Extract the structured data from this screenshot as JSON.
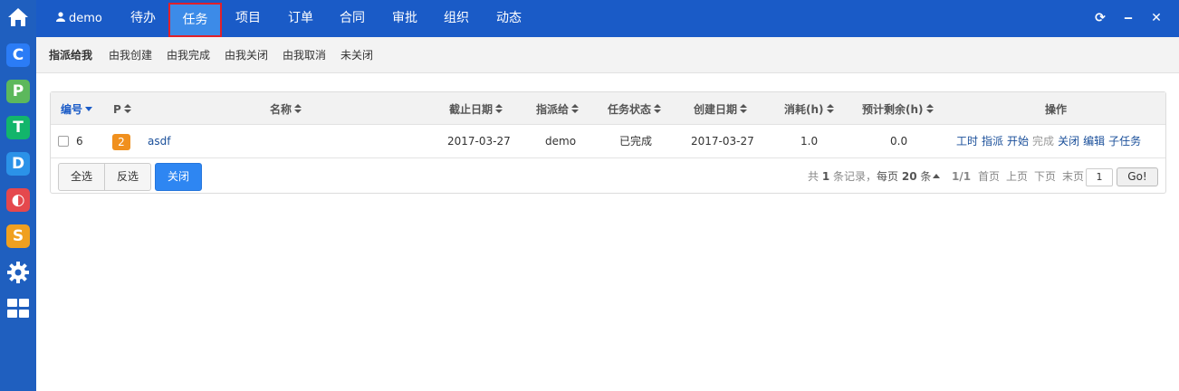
{
  "user": {
    "name": "demo"
  },
  "topnav": {
    "items": [
      {
        "label": "待办"
      },
      {
        "label": "任务"
      },
      {
        "label": "项目"
      },
      {
        "label": "订单"
      },
      {
        "label": "合同"
      },
      {
        "label": "审批"
      },
      {
        "label": "组织"
      },
      {
        "label": "动态"
      }
    ],
    "active": "任务",
    "window_buttons": {
      "refresh": "⟳",
      "minimize": "‒",
      "close": "✕"
    }
  },
  "leftbar": {
    "icons": [
      {
        "name": "home-icon",
        "glyph": "⌂"
      },
      {
        "name": "app-c-icon",
        "glyph": "C"
      },
      {
        "name": "app-p-icon",
        "glyph": "P"
      },
      {
        "name": "app-t-icon",
        "glyph": "T"
      },
      {
        "name": "app-d-icon",
        "glyph": "D"
      },
      {
        "name": "app-o-icon",
        "glyph": "◐"
      },
      {
        "name": "app-s-icon",
        "glyph": "S"
      },
      {
        "name": "gear-icon",
        "glyph": "⚙"
      },
      {
        "name": "grid-icon",
        "glyph": "▦"
      }
    ]
  },
  "subnav": {
    "items": [
      {
        "label": "指派给我"
      },
      {
        "label": "由我创建"
      },
      {
        "label": "由我完成"
      },
      {
        "label": "由我关闭"
      },
      {
        "label": "由我取消"
      },
      {
        "label": "未关闭"
      }
    ],
    "active": "指派给我"
  },
  "table": {
    "headers": {
      "id": "编号",
      "priority": "P",
      "name": "名称",
      "deadline": "截止日期",
      "assigned_to": "指派给",
      "status": "任务状态",
      "created": "创建日期",
      "consumed": "消耗(h)",
      "left": "预计剩余(h)",
      "actions": "操作"
    },
    "rows": [
      {
        "id": "6",
        "priority": "2",
        "name": "asdf",
        "deadline": "2017-03-27",
        "assigned_to": "demo",
        "status": "已完成",
        "created": "2017-03-27",
        "consumed": "1.0",
        "left": "0.0",
        "actions": [
          {
            "label": "工时",
            "enabled": true
          },
          {
            "label": "指派",
            "enabled": true
          },
          {
            "label": "开始",
            "enabled": true
          },
          {
            "label": "完成",
            "enabled": false
          },
          {
            "label": "关闭",
            "enabled": true
          },
          {
            "label": "编辑",
            "enabled": true
          },
          {
            "label": "子任务",
            "enabled": true
          }
        ]
      }
    ]
  },
  "footer": {
    "select_all": "全选",
    "invert": "反选",
    "close": "关闭",
    "pager": {
      "total_prefix": "共",
      "total": "1",
      "total_suffix": "条记录，",
      "per_page_prefix": "每页",
      "per_page": "20",
      "per_page_suffix": "条",
      "page_info": "1/1",
      "first": "首页",
      "prev": "上页",
      "next": "下页",
      "last": "末页",
      "page_input": "1",
      "go": "Go!"
    }
  }
}
